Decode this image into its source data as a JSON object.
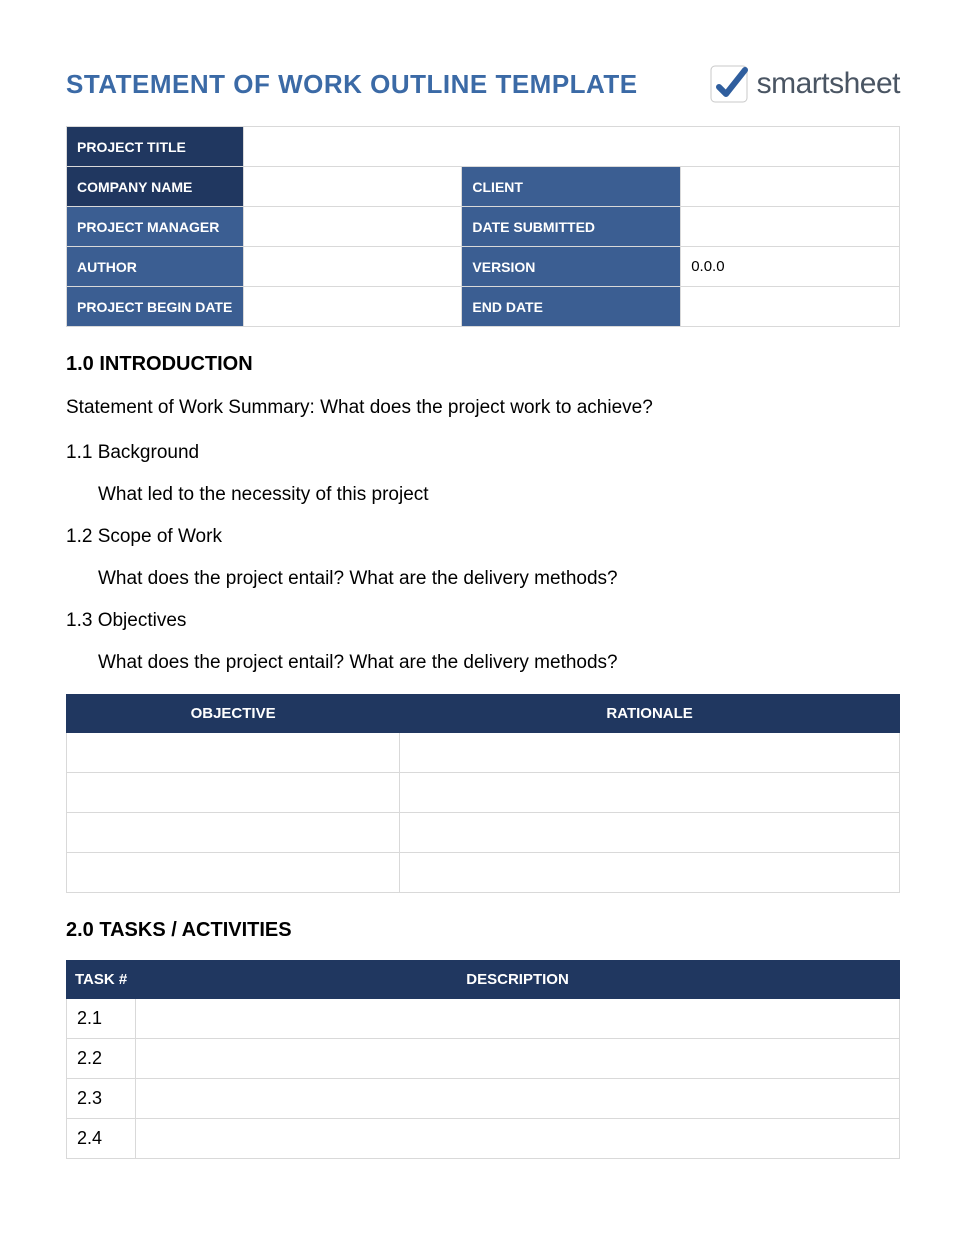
{
  "title": "STATEMENT OF WORK OUTLINE TEMPLATE",
  "logo": {
    "text_a": "smart",
    "text_b": "sheet"
  },
  "meta": {
    "project_title_label": "PROJECT TITLE",
    "project_title": "",
    "company_name_label": "COMPANY NAME",
    "company_name": "",
    "client_label": "CLIENT",
    "client": "",
    "project_manager_label": "PROJECT MANAGER",
    "project_manager": "",
    "date_submitted_label": "DATE SUBMITTED",
    "date_submitted": "",
    "author_label": "AUTHOR",
    "author": "",
    "version_label": "VERSION",
    "version": "0.0.0",
    "begin_date_label": "PROJECT BEGIN DATE",
    "begin_date": "",
    "end_date_label": "END DATE",
    "end_date": ""
  },
  "sections": {
    "intro_h": "1.0 INTRODUCTION",
    "summary": "Statement of Work Summary: What does the project work to achieve?",
    "s11": "1.1 Background",
    "s11b": "What led to the necessity of this project",
    "s12": "1.2 Scope of Work",
    "s12b": "What does the project entail? What are the delivery methods?",
    "s13": "1.3 Objectives",
    "s13b": "What does the project entail? What are the delivery methods?",
    "obj_h1": "OBJECTIVE",
    "obj_h2": "RATIONALE",
    "objectives": [
      {
        "objective": "",
        "rationale": ""
      },
      {
        "objective": "",
        "rationale": ""
      },
      {
        "objective": "",
        "rationale": ""
      },
      {
        "objective": "",
        "rationale": ""
      }
    ],
    "tasks_h": "2.0 TASKS / ACTIVITIES",
    "task_col1": "TASK #",
    "task_col2": "DESCRIPTION",
    "tasks": [
      {
        "num": "2.1",
        "desc": ""
      },
      {
        "num": "2.2",
        "desc": ""
      },
      {
        "num": "2.3",
        "desc": ""
      },
      {
        "num": "2.4",
        "desc": ""
      }
    ]
  }
}
